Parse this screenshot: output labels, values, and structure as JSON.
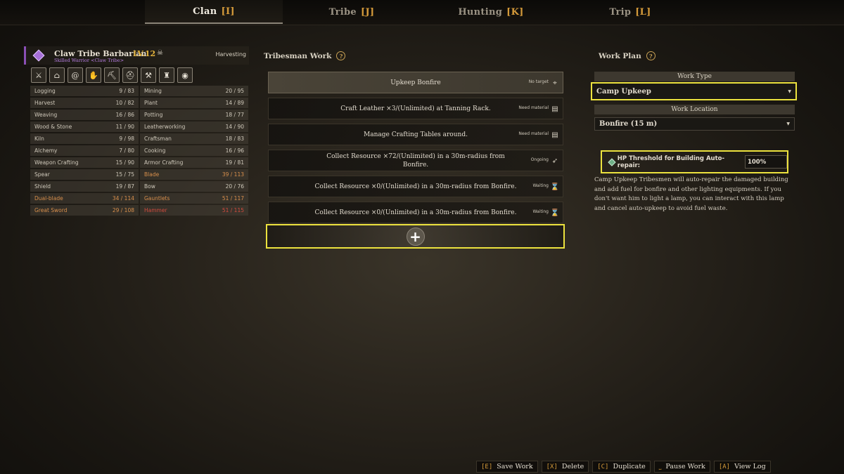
{
  "tabs": [
    {
      "label": "Clan",
      "key": "[I]"
    },
    {
      "label": "Tribe",
      "key": "[J]"
    },
    {
      "label": "Hunting",
      "key": "[K]"
    },
    {
      "label": "Trip",
      "key": "[L]"
    }
  ],
  "character": {
    "name": "Claw Tribe Barbarian",
    "level": "LV.12",
    "subtitle": "Skilled Warrior <Claw Tribe>",
    "status": "Harvesting",
    "skill_icons": [
      "sword-shield-icon",
      "boot-icon",
      "spiral-icon",
      "spiral-hand-icon",
      "pickaxe-icon",
      "helmet-icon",
      "anvil-icon",
      "bell-icon",
      "eye-icon"
    ],
    "stats": [
      {
        "left": {
          "name": "Logging",
          "value": "9 / 83"
        },
        "right": {
          "name": "Mining",
          "value": "20 / 95"
        }
      },
      {
        "left": {
          "name": "Harvest",
          "value": "10 / 82"
        },
        "right": {
          "name": "Plant",
          "value": "14 / 89"
        }
      },
      {
        "left": {
          "name": "Weaving",
          "value": "16 / 86"
        },
        "right": {
          "name": "Potting",
          "value": "18 / 77"
        }
      },
      {
        "left": {
          "name": "Wood & Stone",
          "value": "11 / 90"
        },
        "right": {
          "name": "Leatherworking",
          "value": "14 / 90"
        }
      },
      {
        "left": {
          "name": "Kiln",
          "value": "9 / 98"
        },
        "right": {
          "name": "Craftsman",
          "value": "18 / 83"
        }
      },
      {
        "left": {
          "name": "Alchemy",
          "value": "7 / 80"
        },
        "right": {
          "name": "Cooking",
          "value": "16 / 96"
        }
      },
      {
        "left": {
          "name": "Weapon Crafting",
          "value": "15 / 90"
        },
        "right": {
          "name": "Armor Crafting",
          "value": "19 / 81"
        }
      },
      {
        "left": {
          "name": "Spear",
          "value": "15 / 75"
        },
        "right": {
          "name": "Blade",
          "value": "39 / 113"
        }
      },
      {
        "left": {
          "name": "Shield",
          "value": "19 / 87"
        },
        "right": {
          "name": "Bow",
          "value": "20 / 76"
        }
      },
      {
        "left": {
          "name": "Dual-blade",
          "value": "34 / 114"
        },
        "right": {
          "name": "Gauntlets",
          "value": "51 / 117"
        }
      },
      {
        "left": {
          "name": "Great Sword",
          "value": "29 / 108"
        },
        "right": {
          "name": "Hammer",
          "value": "51 / 115"
        }
      }
    ],
    "stat_colors": {
      "normal": "#cfc8ba",
      "highlight": "#d88f4c",
      "max": "#d24b3e"
    }
  },
  "tribesman_work": {
    "title": "Tribesman Work",
    "items": [
      {
        "text": "Upkeep Bonfire",
        "status": "No target",
        "icon": "target-icon"
      },
      {
        "text": "Craft Leather ×3/(Unlimited) at Tanning Rack.",
        "status": "Need material",
        "icon": "material-icon"
      },
      {
        "text": "Manage Crafting Tables around.",
        "status": "Need material",
        "icon": "material-icon"
      },
      {
        "text": "Collect Resource ×72/(Unlimited) in a 30m-radius from Bonfire.",
        "status": "Ongoing",
        "icon": "running-icon"
      },
      {
        "text": "Collect Resource ×0/(Unlimited) in a 30m-radius from Bonfire.",
        "status": "Waiting",
        "icon": "hourglass-icon"
      },
      {
        "text": "Collect Resource ×0/(Unlimited) in a 30m-radius from Bonfire.",
        "status": "Waiting",
        "icon": "hourglass-icon"
      }
    ]
  },
  "work_plan": {
    "title": "Work Plan",
    "work_type_label": "Work Type",
    "work_type_value": "Camp Upkeep",
    "work_location_label": "Work Location",
    "work_location_value": "Bonfire (15 m)",
    "hp_threshold_label": "HP Threshold for Building Auto-repair:",
    "hp_threshold_value": "100%",
    "description": "Camp Upkeep Tribesmen will auto-repair the damaged building and add fuel for bonfire and other lighting equipments. If you don't want him to light a lamp, you can interact with this lamp and cancel auto-upkeep to avoid fuel waste."
  },
  "actions": [
    {
      "key": "[E]",
      "label": "Save Work"
    },
    {
      "key": "[X]",
      "label": "Delete"
    },
    {
      "key": "[C]",
      "label": "Duplicate"
    },
    {
      "key": "⎵",
      "label": "Pause Work"
    },
    {
      "key": "[A]",
      "label": "View Log"
    }
  ],
  "colors": {
    "accent": "#d49a3a",
    "highlight_border": "#ece23e",
    "level": "#e2b23c",
    "rarity": "#a66fd8"
  }
}
